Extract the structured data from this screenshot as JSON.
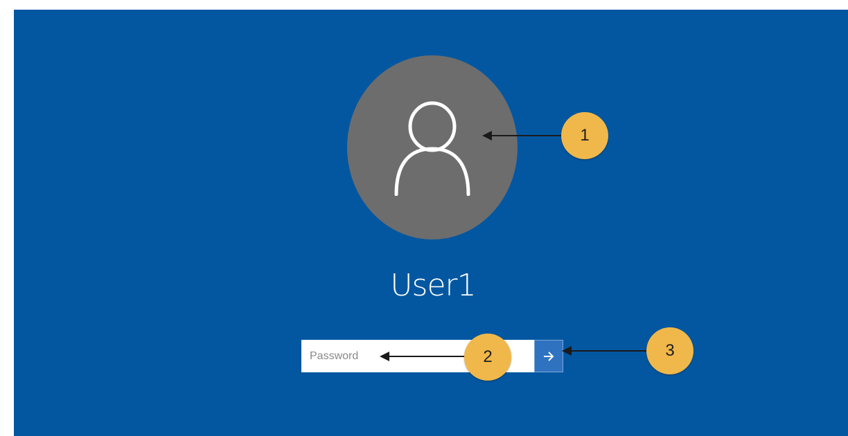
{
  "colors": {
    "background": "#0357a1",
    "avatar": "#6d6d6d",
    "submit_button": "#2f73c0",
    "callout": "#f0b84a"
  },
  "login": {
    "username": "User1",
    "password_placeholder": "Password",
    "submit_icon": "arrow-right-icon",
    "avatar_icon": "user-icon"
  },
  "callouts": [
    {
      "number": "1"
    },
    {
      "number": "2"
    },
    {
      "number": "3"
    }
  ]
}
